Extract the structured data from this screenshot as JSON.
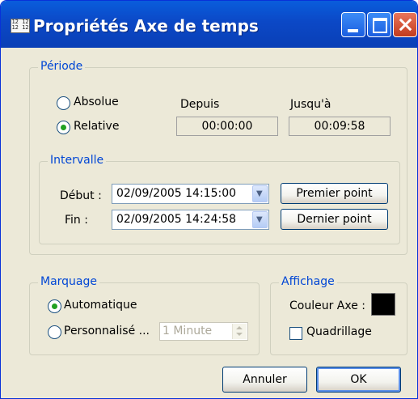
{
  "window": {
    "title": "Propriétés Axe de temps",
    "icon_text": "12 12\n12 12"
  },
  "periode": {
    "legend": "Période",
    "absolue_label": "Absolue",
    "relative_label": "Relative",
    "selected": "Relative",
    "depuis_label": "Depuis",
    "depuis_value": "00:00:00",
    "jusqua_label": "Jusqu'à",
    "jusqua_value": "00:09:58"
  },
  "intervalle": {
    "legend": "Intervalle",
    "debut_label": "Début :",
    "debut_value": "02/09/2005 14:15:00",
    "fin_label": "Fin :",
    "fin_value": "02/09/2005 14:24:58",
    "premier_button": "Premier  point",
    "dernier_button": "Dernier point"
  },
  "marquage": {
    "legend": "Marquage",
    "auto_label": "Automatique",
    "perso_label": "Personnalisé ...",
    "selected": "Automatique",
    "interval_value": "1 Minute"
  },
  "affichage": {
    "legend": "Affichage",
    "couleur_label": "Couleur Axe :",
    "axis_color": "#000000",
    "quadrillage_label": "Quadrillage",
    "quadrillage_checked": false
  },
  "buttons": {
    "cancel": "Annuler",
    "ok": "OK"
  },
  "colors": {
    "titlebar": "#0a5ddc",
    "legend_text": "#0046d5",
    "face": "#ece9d8",
    "radio_dot": "#21a121"
  }
}
